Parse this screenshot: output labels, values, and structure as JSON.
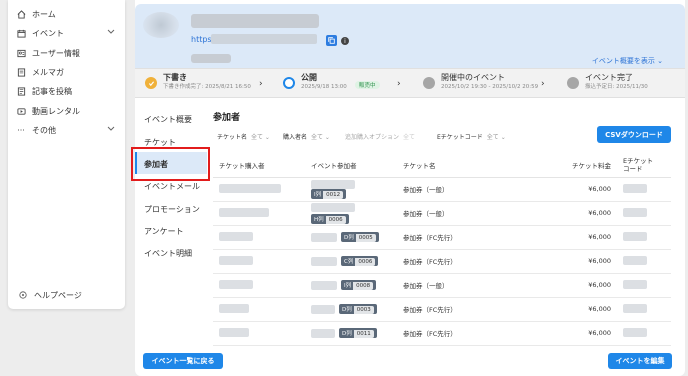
{
  "sidebar": {
    "items": [
      {
        "label": "ホーム",
        "icon": "home-icon"
      },
      {
        "label": "イベント",
        "icon": "calendar-icon",
        "expandable": true
      },
      {
        "label": "ユーザー情報",
        "icon": "user-card-icon"
      },
      {
        "label": "メルマガ",
        "icon": "mail-icon"
      },
      {
        "label": "記事を投稿",
        "icon": "document-icon"
      },
      {
        "label": "動画レンタル",
        "icon": "video-icon"
      },
      {
        "label": "その他",
        "icon": "more-icon",
        "expandable": true
      }
    ],
    "help": {
      "label": "ヘルプページ",
      "icon": "help-icon"
    }
  },
  "header": {
    "url_prefix": "https://",
    "show_summary": "イベント概要を表示 ⌄"
  },
  "steps": [
    {
      "title": "下書き",
      "detail": "下書き作成完了: 2025/8/21 16:50",
      "state": "done",
      "color": "#f0b13a"
    },
    {
      "title": "公開",
      "detail": "2025/9/18 13:00",
      "badge": "販売中",
      "state": "current",
      "color": "#1f87e8"
    },
    {
      "title": "開催中のイベント",
      "detail": "2025/10/2 19:30 - 2025/10/2 20:59",
      "state": "pending",
      "color": "#a6a6a6"
    },
    {
      "title": "イベント完了",
      "detail": "振込予定日: 2025/11/30",
      "state": "pending",
      "color": "#a6a6a6"
    }
  ],
  "subnav": {
    "items": [
      "イベント概要",
      "チケット",
      "参加者",
      "イベントメール",
      "プロモーション",
      "アンケート",
      "イベント明細"
    ],
    "active": "参加者"
  },
  "content": {
    "title": "参加者",
    "filters": [
      {
        "label": "チケット名",
        "value": "全て ⌄"
      },
      {
        "label": "購入者名",
        "value": "全て ⌄"
      },
      {
        "label": "追加購入オプション",
        "value": "全て"
      },
      {
        "label": "Eチケットコード",
        "value": "全て ⌄"
      }
    ],
    "csv_button": "CSVダウンロード",
    "columns": [
      "チケット購入者",
      "イベント参加者",
      "チケット名",
      "チケット料金",
      "Eチケット\nコード"
    ],
    "rows": [
      {
        "seat_row": "I列",
        "seat_num": "0012",
        "ticket": "参加券（一般）",
        "price": "¥6,000"
      },
      {
        "seat_row": "H列",
        "seat_num": "0006",
        "ticket": "参加券（一般）",
        "price": "¥6,000"
      },
      {
        "seat_row": "D列",
        "seat_num": "0005",
        "ticket": "参加券（FC先行）",
        "price": "¥6,000"
      },
      {
        "seat_row": "C列",
        "seat_num": "0006",
        "ticket": "参加券（FC先行）",
        "price": "¥6,000"
      },
      {
        "seat_row": "I列",
        "seat_num": "0008",
        "ticket": "参加券（一般）",
        "price": "¥6,000"
      },
      {
        "seat_row": "D列",
        "seat_num": "0003",
        "ticket": "参加券（FC先行）",
        "price": "¥6,000"
      },
      {
        "seat_row": "D列",
        "seat_num": "0011",
        "ticket": "参加券（FC先行）",
        "price": "¥6,000"
      }
    ]
  },
  "footer": {
    "back_button": "イベント一覧に戻る",
    "edit_button": "イベントを編集"
  }
}
